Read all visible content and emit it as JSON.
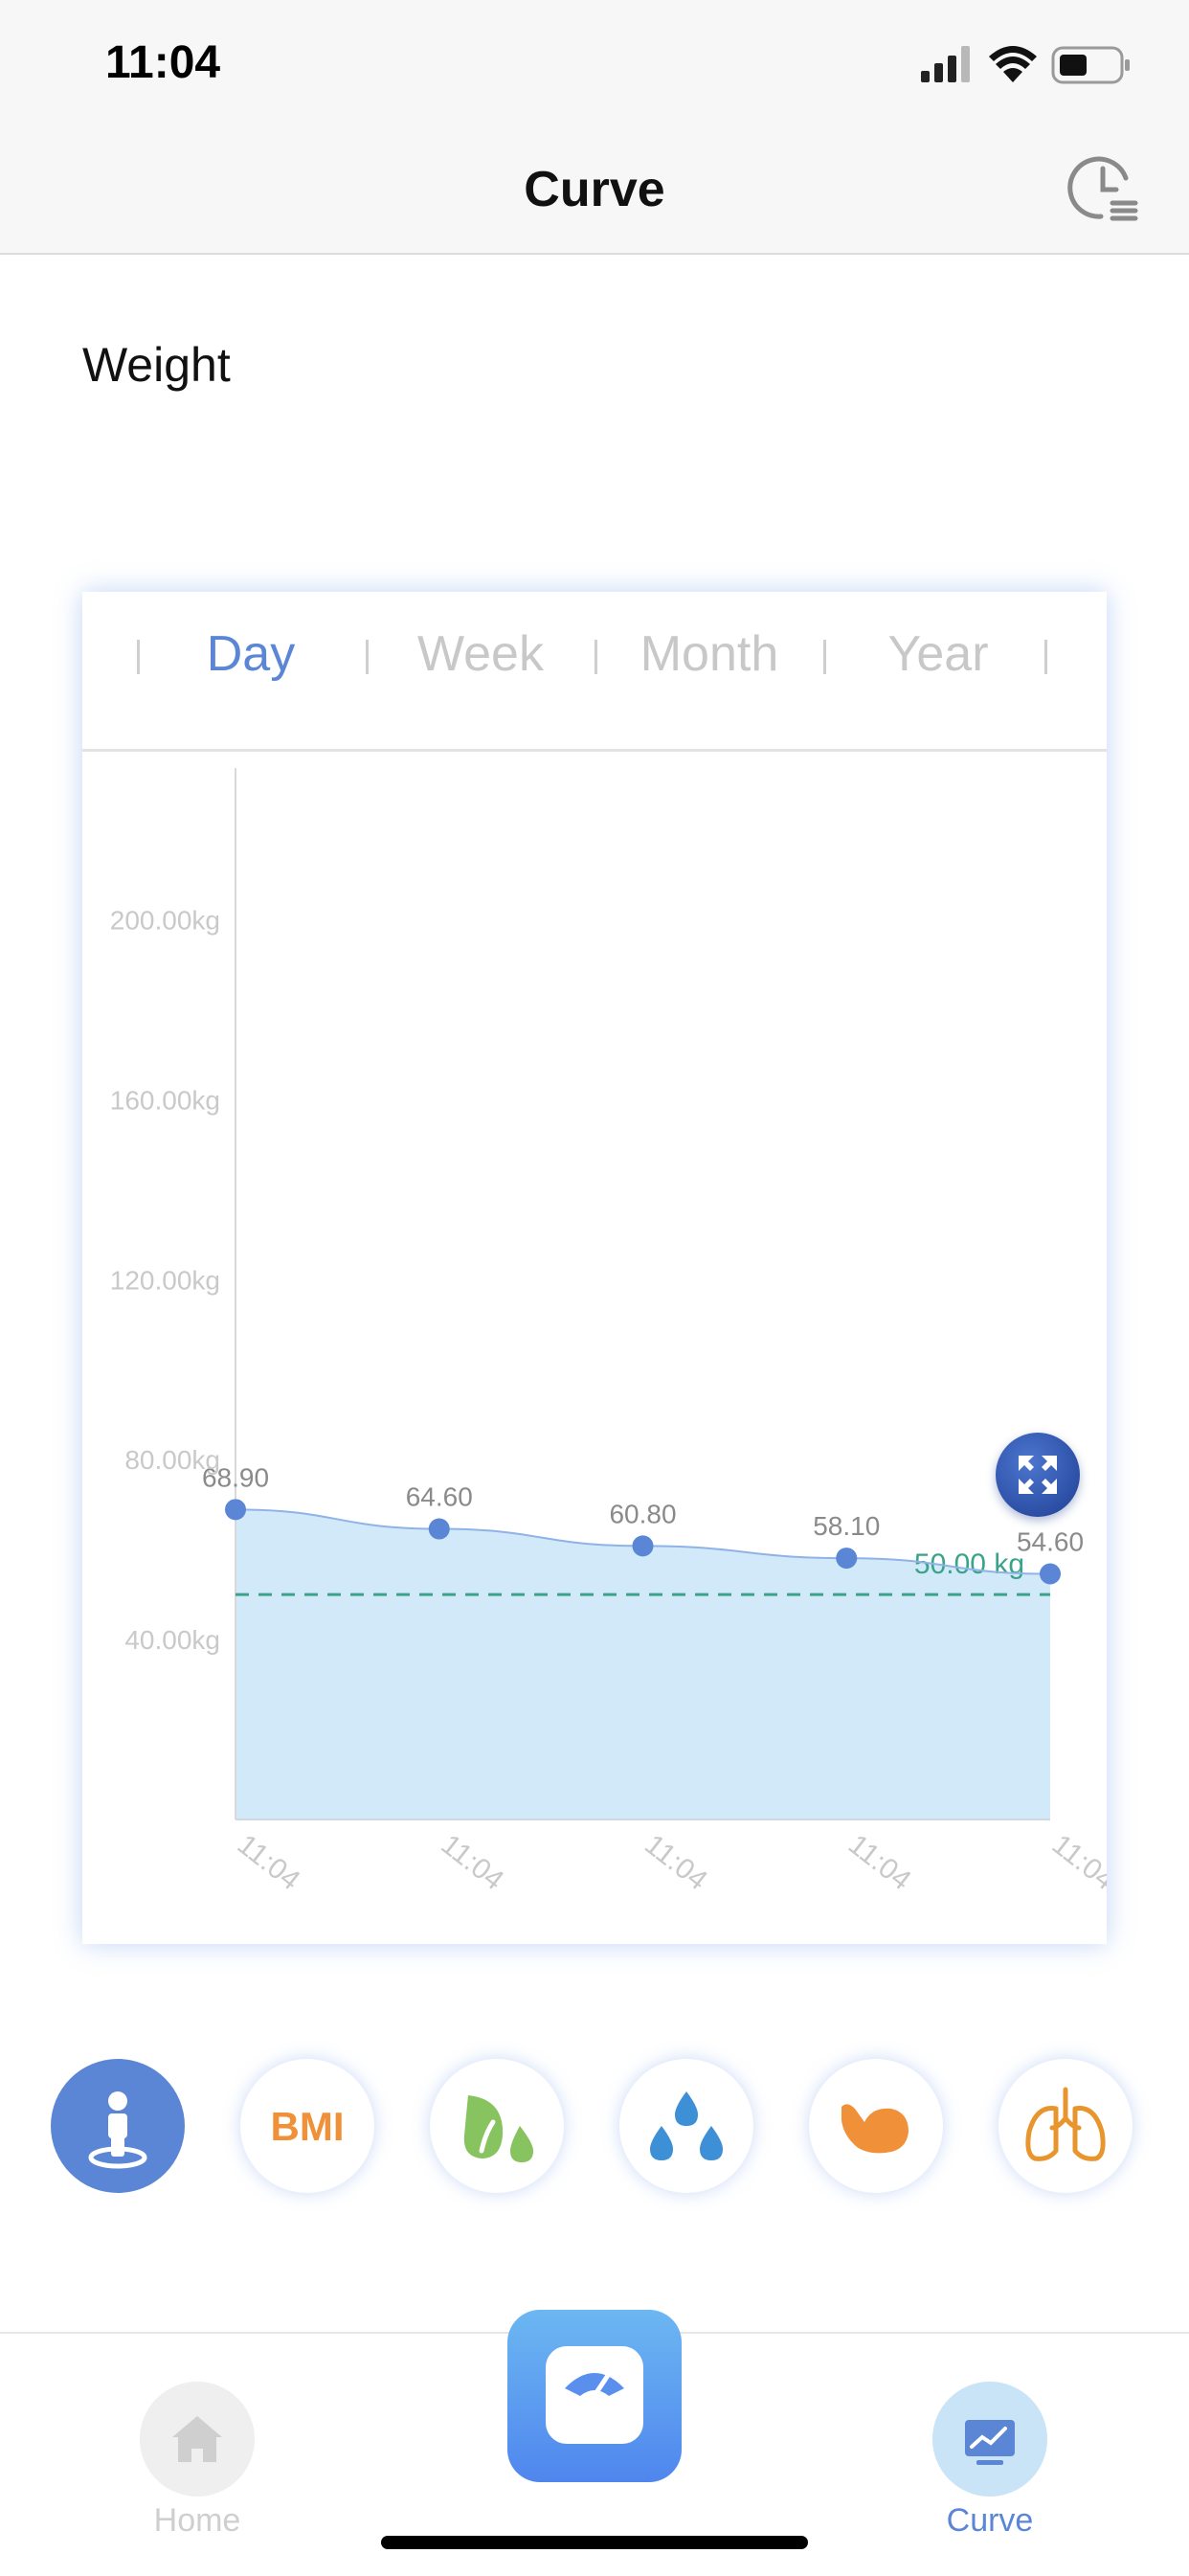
{
  "status_bar": {
    "time": "11:04"
  },
  "nav": {
    "title": "Curve",
    "history_icon": "clock-history-icon"
  },
  "section": {
    "title": "Weight"
  },
  "tabs": [
    {
      "label": "Day",
      "active": true
    },
    {
      "label": "Week",
      "active": false
    },
    {
      "label": "Month",
      "active": false
    },
    {
      "label": "Year",
      "active": false
    }
  ],
  "chart_data": {
    "type": "area",
    "title": "",
    "xlabel": "",
    "ylabel": "",
    "x": [
      "11:04",
      "11:04",
      "11:04",
      "11:04",
      "11:04"
    ],
    "series": [
      {
        "values": [
          68.9,
          64.6,
          60.8,
          58.1,
          54.6
        ],
        "data_labels": [
          "68.90",
          "64.60",
          "60.80",
          "58.10",
          "54.60"
        ]
      }
    ],
    "y_ticks": [
      40,
      80,
      120,
      160,
      200
    ],
    "y_tick_labels": [
      "40.00kg",
      "80.00kg",
      "120.00kg",
      "160.00kg",
      "200.00kg"
    ],
    "ylim": [
      0,
      238
    ],
    "target_line": {
      "value": 50,
      "label": "50.00 kg",
      "style": "dashed"
    },
    "grid": false,
    "colors": {
      "line": "#5b86d6",
      "fill": "#d2e9f9",
      "target": "#3aa38a",
      "axis_text": "#c9c9c9",
      "label_text": "#8a8a8a"
    }
  },
  "metrics": [
    {
      "name": "weight",
      "icon": "person-standing-icon",
      "active": true
    },
    {
      "name": "bmi",
      "label": "BMI",
      "active": false
    },
    {
      "name": "fat",
      "icon": "fat-drops-icon",
      "active": false
    },
    {
      "name": "water",
      "icon": "water-drops-icon",
      "active": false
    },
    {
      "name": "muscle",
      "icon": "muscle-arm-icon",
      "active": false
    },
    {
      "name": "lungs",
      "icon": "lungs-icon",
      "active": false
    }
  ],
  "tabbar": {
    "home": {
      "label": "Home",
      "icon": "home-icon"
    },
    "scale": {
      "icon": "scale-icon"
    },
    "curve": {
      "label": "Curve",
      "icon": "chart-icon"
    }
  },
  "colors": {
    "accent": "#5b86d6",
    "inactive": "#c8c8c8",
    "bmi": "#f0913a"
  }
}
